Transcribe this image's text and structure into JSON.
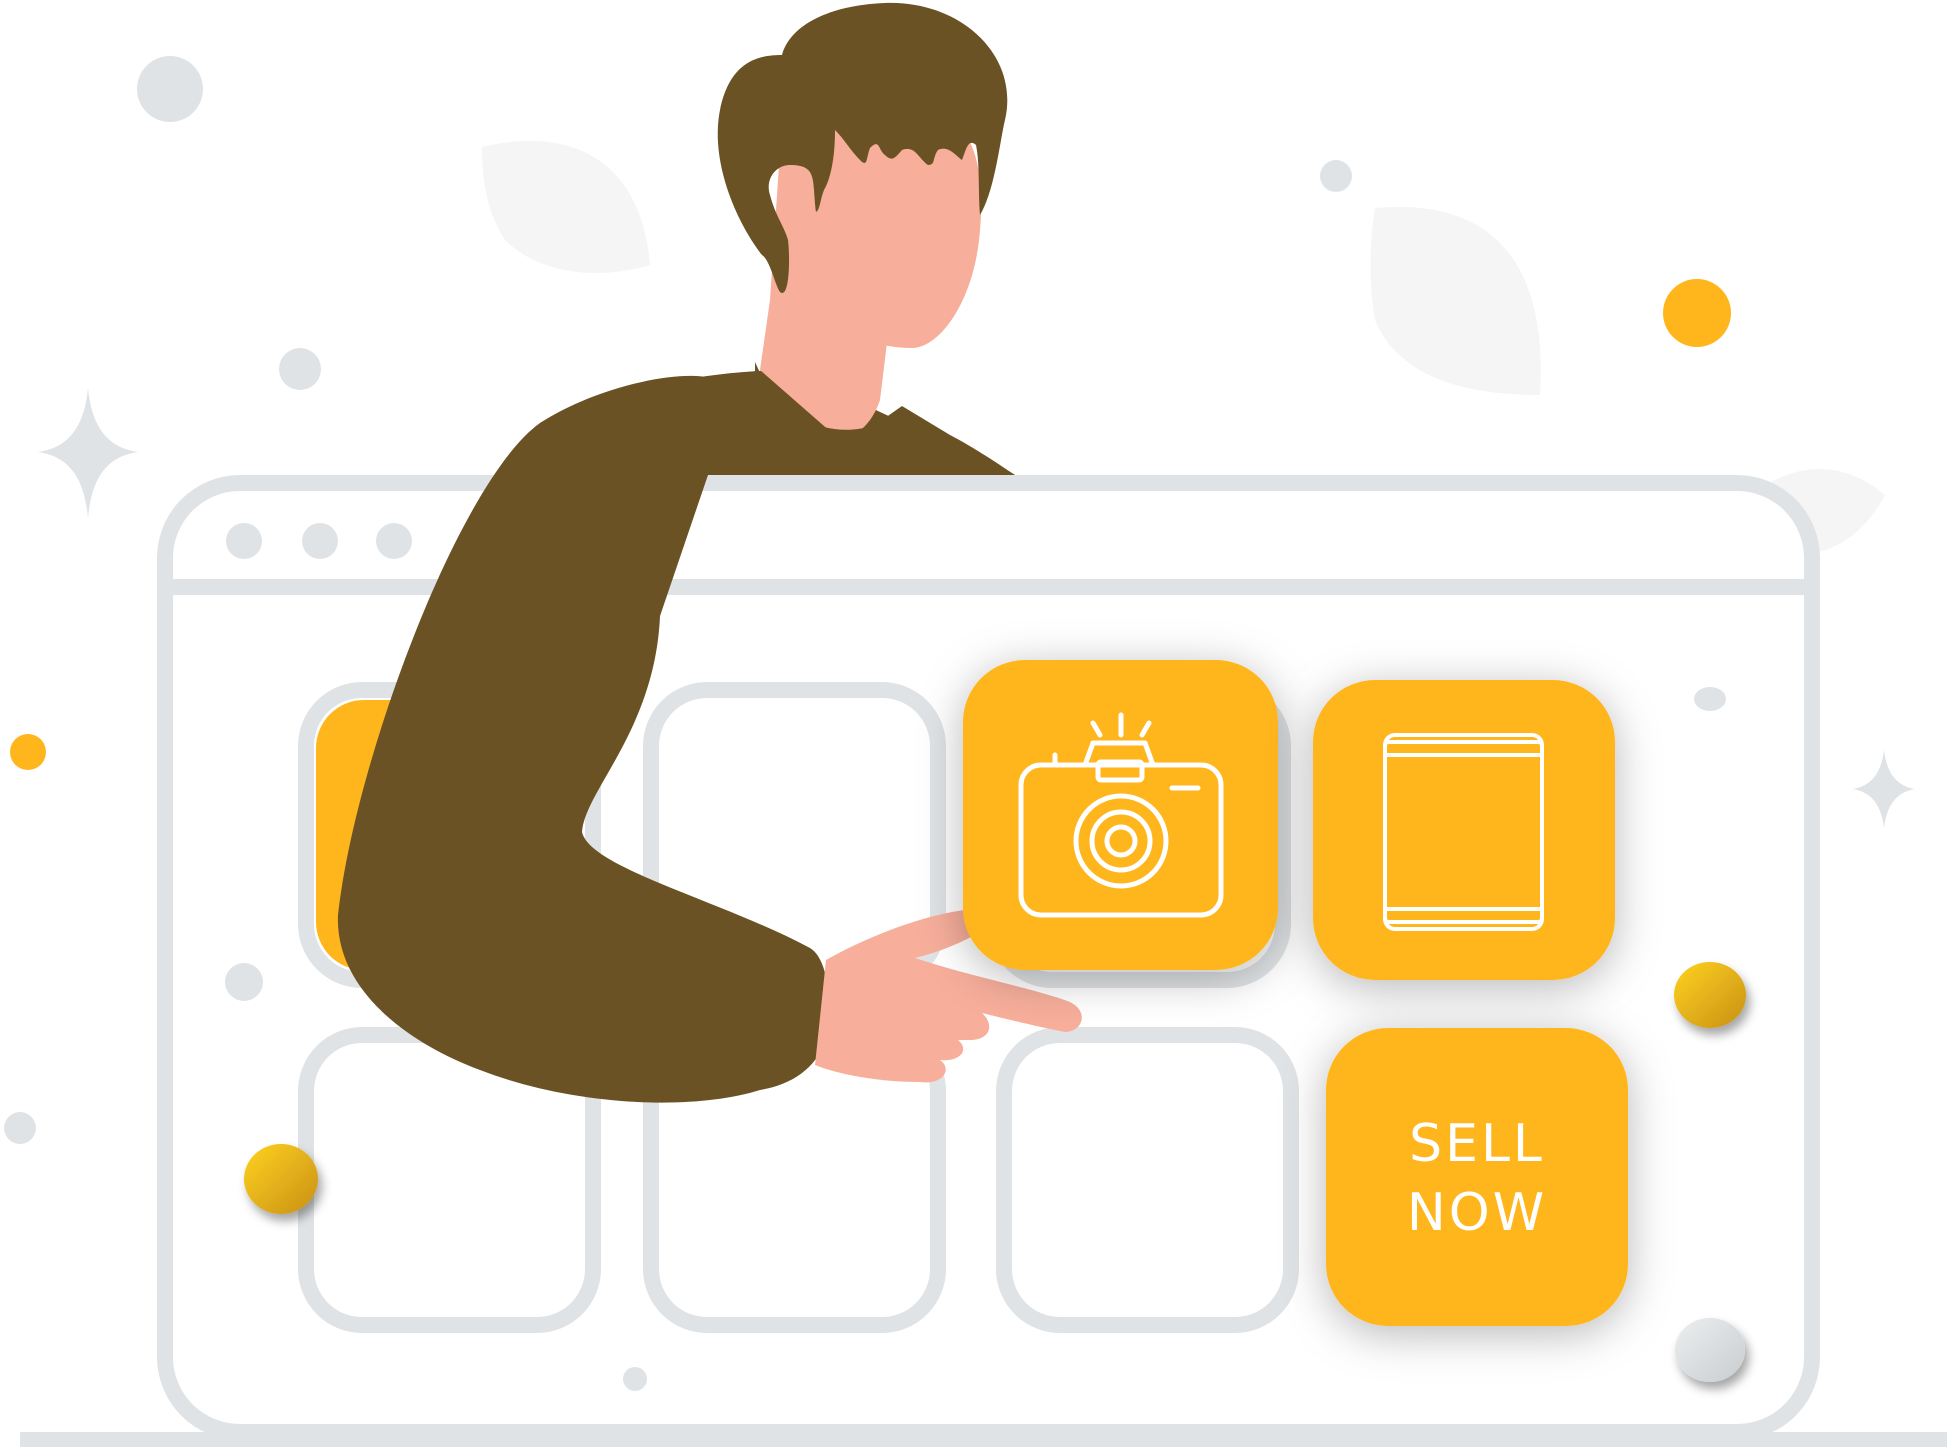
{
  "colors": {
    "outline": "#e0e3e5",
    "dot": "#e0e3e5",
    "accent": "#ffb51c",
    "accent_dark": "#f2a600",
    "coin_light": "#ffd21f",
    "coin_dark": "#c89016",
    "hair": "#6a5224",
    "sweater": "#6a5224",
    "skin": "#f7ae9b",
    "leaf": "#f5f5f5",
    "background": "#ffffff",
    "icon_stroke": "#ffffff"
  },
  "icons": {
    "camera": "camera-icon",
    "tablet": "tablet-icon",
    "sparkle": "sparkle-icon"
  },
  "sell_tile": {
    "line1": "SELL",
    "line2": "NOW"
  }
}
